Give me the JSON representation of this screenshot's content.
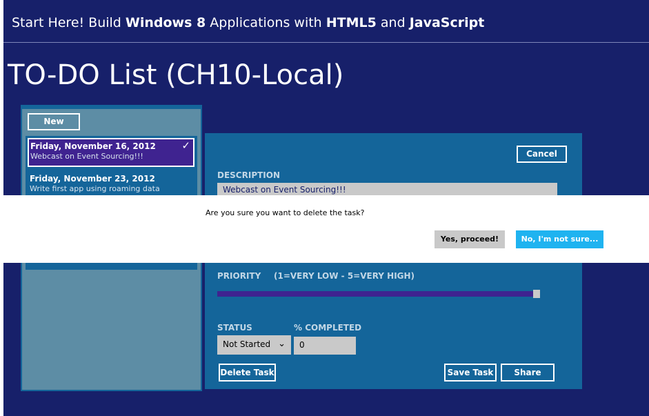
{
  "banner": {
    "prefix": "Start Here! Build ",
    "bold1": "Windows 8",
    "middle": " Applications with ",
    "bold2": "HTML5",
    "and": " and ",
    "bold3": "JavaScript"
  },
  "page_title": "TO-DO List (CH10-Local)",
  "list": {
    "new_label": "New",
    "tasks": [
      {
        "date": "Friday, November 16, 2012",
        "name": "Webcast on Event Sourcing!!!",
        "selected": true
      },
      {
        "date": "Friday, November 23, 2012",
        "name": "Write first app using roaming data",
        "selected": false
      }
    ]
  },
  "detail": {
    "cancel_label": "Cancel",
    "description_label": "DESCRIPTION",
    "description_value": "Webcast on Event Sourcing!!!",
    "priority_label": "PRIORITY",
    "priority_hint": "(1=VERY LOW - 5=VERY HIGH)",
    "priority_value": 5,
    "status_label": "STATUS",
    "pct_label": "% COMPLETED",
    "status_value": "Not Started",
    "pct_value": "0",
    "delete_label": "Delete Task",
    "save_label": "Save Task",
    "share_label": "Share"
  },
  "dialog": {
    "message": "Are you sure you want to delete the task?",
    "yes_label": "Yes, proceed!",
    "no_label": "No, I'm not sure..."
  },
  "colors": {
    "background": "#17206a",
    "panel": "#14659a",
    "accent": "#3f2390",
    "dialog_primary": "#1fb3f0"
  }
}
